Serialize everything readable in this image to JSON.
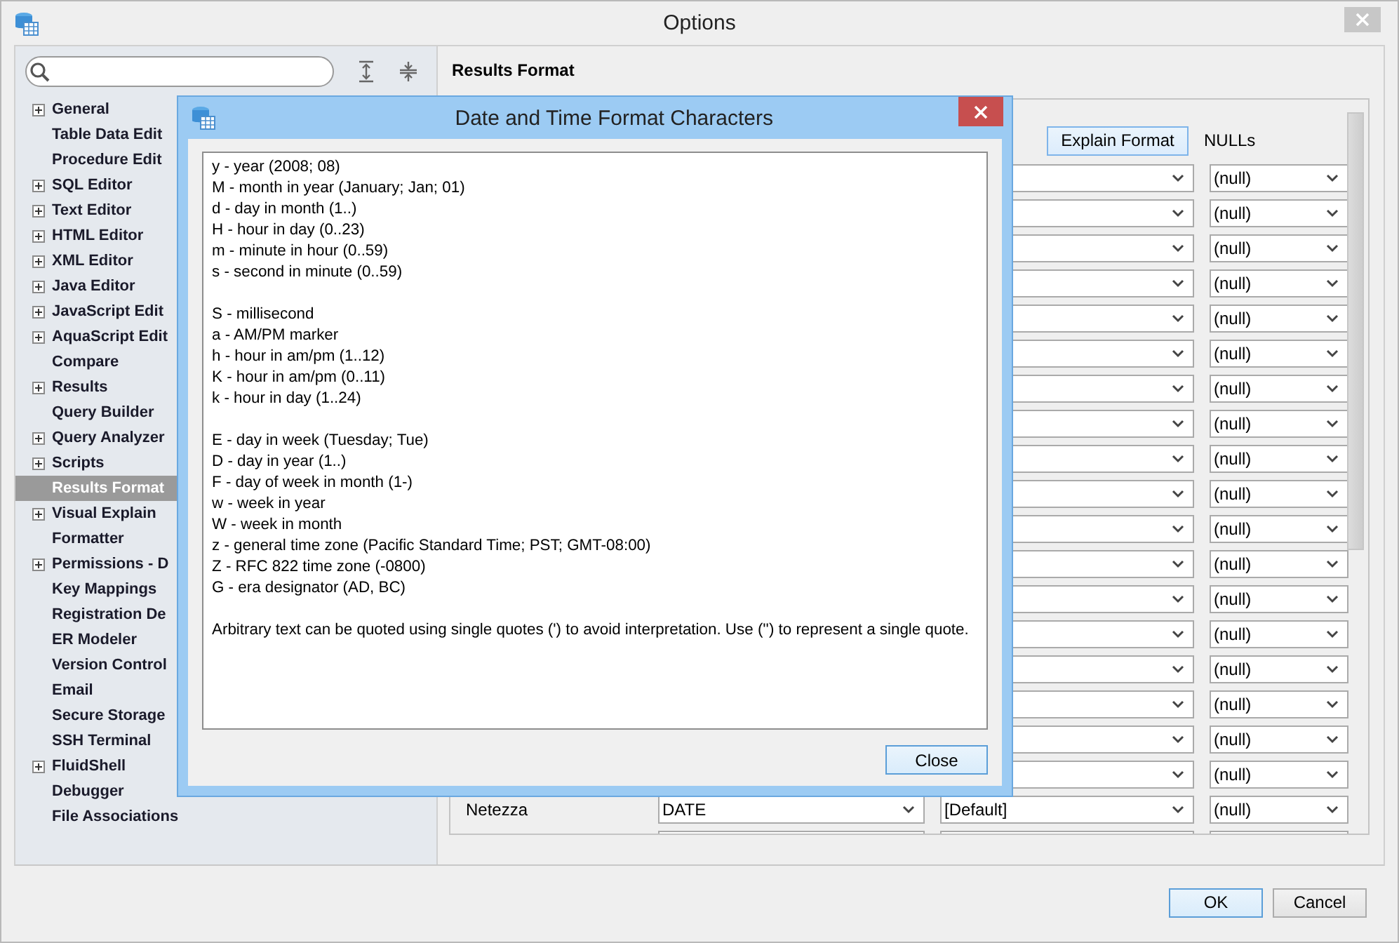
{
  "window": {
    "title": "Options"
  },
  "sidebar": {
    "items": [
      {
        "label": "General",
        "expandable": true,
        "selected": false
      },
      {
        "label": "Table Data Edit",
        "expandable": false,
        "selected": false
      },
      {
        "label": "Procedure Edit",
        "expandable": false,
        "selected": false
      },
      {
        "label": "SQL Editor",
        "expandable": true,
        "selected": false
      },
      {
        "label": "Text Editor",
        "expandable": true,
        "selected": false
      },
      {
        "label": "HTML Editor",
        "expandable": true,
        "selected": false
      },
      {
        "label": "XML Editor",
        "expandable": true,
        "selected": false
      },
      {
        "label": "Java Editor",
        "expandable": true,
        "selected": false
      },
      {
        "label": "JavaScript Edit",
        "expandable": true,
        "selected": false
      },
      {
        "label": "AquaScript Edit",
        "expandable": true,
        "selected": false
      },
      {
        "label": "Compare",
        "expandable": false,
        "selected": false
      },
      {
        "label": "Results",
        "expandable": true,
        "selected": false
      },
      {
        "label": "Query Builder",
        "expandable": false,
        "selected": false
      },
      {
        "label": "Query Analyzer",
        "expandable": true,
        "selected": false
      },
      {
        "label": "Scripts",
        "expandable": true,
        "selected": false
      },
      {
        "label": "Results Format",
        "expandable": false,
        "selected": true
      },
      {
        "label": "Visual Explain",
        "expandable": true,
        "selected": false
      },
      {
        "label": "Formatter",
        "expandable": false,
        "selected": false
      },
      {
        "label": "Permissions - D",
        "expandable": true,
        "selected": false
      },
      {
        "label": "Key Mappings",
        "expandable": false,
        "selected": false
      },
      {
        "label": "Registration De",
        "expandable": false,
        "selected": false
      },
      {
        "label": "ER Modeler",
        "expandable": false,
        "selected": false
      },
      {
        "label": "Version Control",
        "expandable": false,
        "selected": false
      },
      {
        "label": "Email",
        "expandable": false,
        "selected": false
      },
      {
        "label": "Secure Storage",
        "expandable": false,
        "selected": false
      },
      {
        "label": "SSH Terminal",
        "expandable": false,
        "selected": false
      },
      {
        "label": "FluidShell",
        "expandable": true,
        "selected": false
      },
      {
        "label": "Debugger",
        "expandable": false,
        "selected": false
      },
      {
        "label": "File Associations",
        "expandable": false,
        "selected": false
      }
    ]
  },
  "panel": {
    "title": "Results Format",
    "explain_button": "Explain Format",
    "nulls_header": "NULLs",
    "rows": [
      {
        "kind": "setting",
        "nulls": "(null)"
      },
      {
        "kind": "setting",
        "nulls": "(null)"
      },
      {
        "kind": "setting",
        "nulls": "(null)"
      },
      {
        "kind": "setting",
        "nulls": "(null)"
      },
      {
        "kind": "setting",
        "nulls": "(null)"
      },
      {
        "kind": "setting",
        "nulls": "(null)"
      },
      {
        "kind": "setting",
        "nulls": "(null)"
      },
      {
        "kind": "setting",
        "nulls": "(null)"
      },
      {
        "kind": "setting",
        "nulls": "(null)"
      },
      {
        "kind": "setting",
        "nulls": "(null)"
      },
      {
        "kind": "setting",
        "nulls": "(null)"
      },
      {
        "kind": "setting",
        "nulls": "(null)"
      },
      {
        "kind": "setting",
        "nulls": "(null)"
      },
      {
        "kind": "setting",
        "nulls": "(null)"
      },
      {
        "kind": "setting",
        "nulls": "(null)"
      },
      {
        "kind": "setting",
        "nulls": "(null)"
      },
      {
        "kind": "setting",
        "nulls": "(null)"
      },
      {
        "kind": "setting",
        "nulls": "(null)"
      },
      {
        "kind": "setting",
        "label": "Netezza",
        "format": "DATE",
        "type": "[Default]",
        "nulls": "(null)"
      },
      {
        "kind": "partial"
      }
    ]
  },
  "buttons": [
    "OK",
    "Cancel"
  ],
  "dialog": {
    "title": "Date and Time Format Characters",
    "sections": [
      [
        "y - year (2008; 08)",
        "M - month in year (January; Jan; 01)",
        "d - day in month (1..)",
        "H - hour in day (0..23)",
        "m - minute in hour (0..59)",
        "s - second in minute (0..59)"
      ],
      [
        "S - millisecond",
        "a - AM/PM marker",
        "h - hour in am/pm (1..12)",
        "K - hour in am/pm (0..11)",
        "k - hour in day (1..24)"
      ],
      [
        "E - day in week (Tuesday; Tue)",
        "D - day in year (1..)",
        "F - day of week in month (1-)",
        "w - week in year",
        "W - week in month",
        "z - general time zone (Pacific Standard Time; PST; GMT-08:00)",
        "Z - RFC 822 time zone (-0800)",
        "G - era designator (AD, BC)"
      ],
      [
        "Arbitrary text can be quoted using single quotes (') to avoid interpretation.  Use ('') to represent a single quote."
      ]
    ],
    "close_button": "Close"
  }
}
